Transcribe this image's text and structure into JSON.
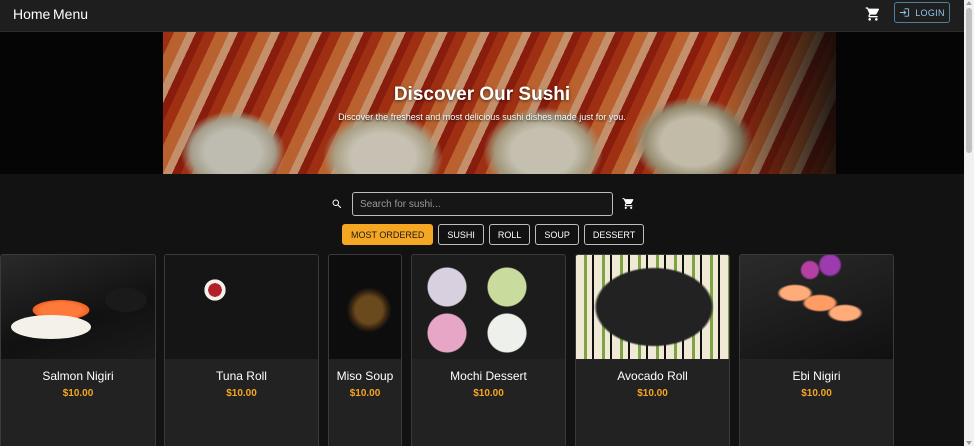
{
  "nav": {
    "home_label": "Home",
    "menu_label": "Menu",
    "cart_icon": "cart-icon",
    "login_label": "LOGIN",
    "login_icon": "login-icon"
  },
  "hero": {
    "title": "Discover Our Sushi",
    "subtitle": "Discover the freshest and most delicious sushi dishes made just for you."
  },
  "search": {
    "placeholder": "Search for sushi...",
    "value": "",
    "icon": "search-icon",
    "cart_icon": "cart-icon"
  },
  "filters": [
    {
      "label": "MOST ORDERED",
      "active": true
    },
    {
      "label": "SUSHI",
      "active": false
    },
    {
      "label": "ROLL",
      "active": false
    },
    {
      "label": "SOUP",
      "active": false
    },
    {
      "label": "DESSERT",
      "active": false
    }
  ],
  "products": [
    {
      "name": "Salmon Nigiri",
      "price": "$10.00"
    },
    {
      "name": "Tuna Roll",
      "price": "$10.00"
    },
    {
      "name": "Miso Soup",
      "price": "$10.00"
    },
    {
      "name": "Mochi Dessert",
      "price": "$10.00"
    },
    {
      "name": "Avocado Roll",
      "price": "$10.00"
    },
    {
      "name": "Ebi Nigiri",
      "price": "$10.00"
    }
  ],
  "colors": {
    "accent": "#f5a623",
    "background": "#121212",
    "card": "#222222",
    "login_border": "#4f7f9e"
  }
}
